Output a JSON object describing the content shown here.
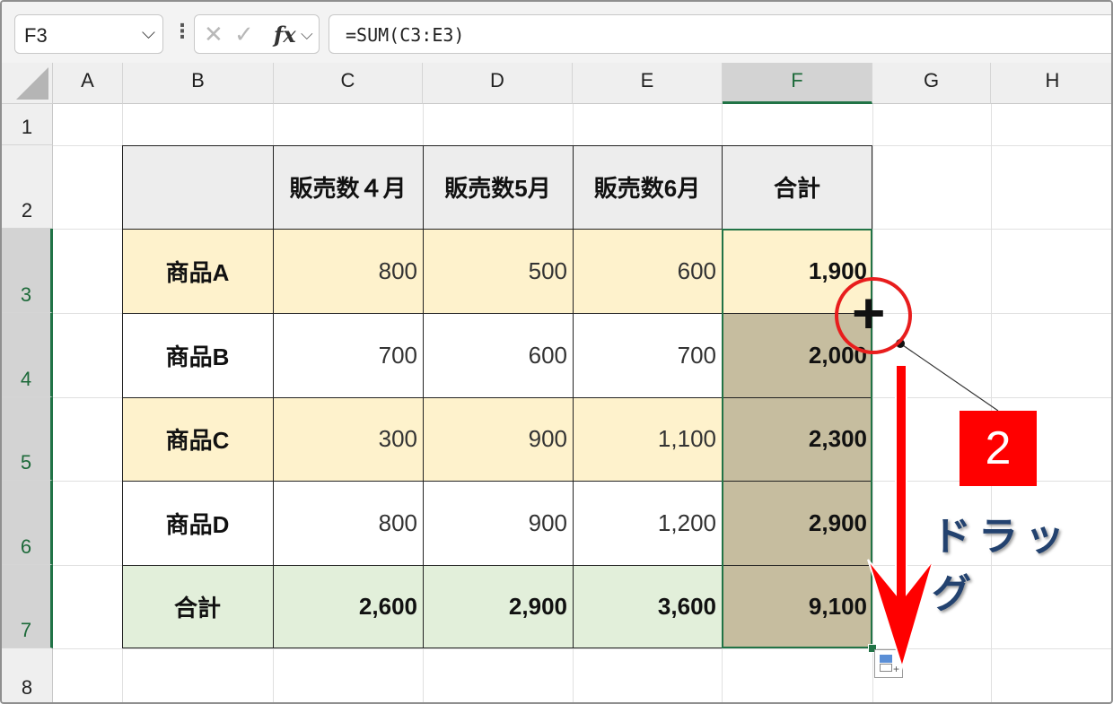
{
  "formula_bar": {
    "name_box": "F3",
    "formula": "=SUM(C3:E3)",
    "cancel_icon": "✕",
    "enter_icon": "✓",
    "fx_label": "fx"
  },
  "columns": [
    "A",
    "B",
    "C",
    "D",
    "E",
    "F",
    "G",
    "H"
  ],
  "rows": [
    "1",
    "2",
    "3",
    "4",
    "5",
    "6",
    "7",
    "8"
  ],
  "table": {
    "headers": [
      "",
      "販売数４月",
      "販売数5月",
      "販売数6月",
      "合計"
    ],
    "rows": [
      {
        "label": "商品A",
        "c": "800",
        "d": "500",
        "e": "600",
        "f": "1,900"
      },
      {
        "label": "商品B",
        "c": "700",
        "d": "600",
        "e": "700",
        "f": "2,000"
      },
      {
        "label": "商品C",
        "c": "300",
        "d": "900",
        "e": "1,100",
        "f": "2,300"
      },
      {
        "label": "商品D",
        "c": "800",
        "d": "900",
        "e": "1,200",
        "f": "2,900"
      },
      {
        "label": "合計",
        "c": "2,600",
        "d": "2,900",
        "e": "3,600",
        "f": "9,100"
      }
    ]
  },
  "colors": {
    "header_fill": "#ededed",
    "yellow_row": "#fef2cc",
    "total_row": "#e2efda",
    "fill_preview": "#c6bd9f",
    "selection": "#217346",
    "annotation_red": "#e81d1d",
    "annotation_text": "#23426f"
  },
  "annotation": {
    "step_number": "2",
    "label": "ドラッグ",
    "cursor_icon": "fill-handle-crosshair"
  }
}
